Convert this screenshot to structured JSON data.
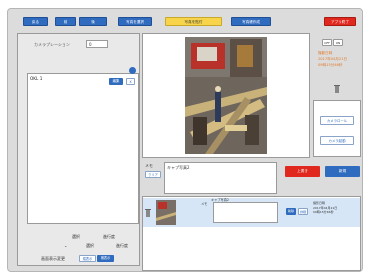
{
  "toolbar": {
    "btn1": "戻る",
    "btn2": "前",
    "btn3": "後",
    "btn4": "写真を選択",
    "btn5": "写真を貼付",
    "btn6": "写真帳作成",
    "btn7": "アプリ終了"
  },
  "left": {
    "field_label": "カメラプレーション",
    "field_value": "0",
    "list_item": "OKL 1",
    "list_btn": "編集",
    "list_btn2": "X",
    "bottom_row1": "選択",
    "bottom_row1b": "進行度",
    "bottom_row2a": "選択",
    "bottom_row2b": "進行度",
    "bottom_label": "画面表示変更",
    "bottom_btn1": "縦表示",
    "bottom_btn2": "横表示"
  },
  "right": {
    "toggle_a": "OFF",
    "toggle_b": "ON",
    "date_lines": [
      "撮影日時",
      "2017年04月21日",
      "09時15分46秒"
    ],
    "btn_camera_roll": "カメラロール",
    "btn_camera_start": "カメラ起動"
  },
  "memo": {
    "label": "メモ",
    "clear": "クリア",
    "text": "キャプ写真2",
    "btn_save": "上書き",
    "btn_new": "新規"
  },
  "entry": {
    "title": "キャプ写真2",
    "memo_label": "メモ",
    "date_label": "撮影日時",
    "date_value": "2017年04月21日\n09時15分46秒",
    "btn_a": "削除",
    "btn_b": "詳細"
  },
  "colors": {
    "accent": "#2f6bbf",
    "danger": "#e0281e",
    "highlight": "#f7d44a",
    "date_text": "#e07a2a"
  }
}
